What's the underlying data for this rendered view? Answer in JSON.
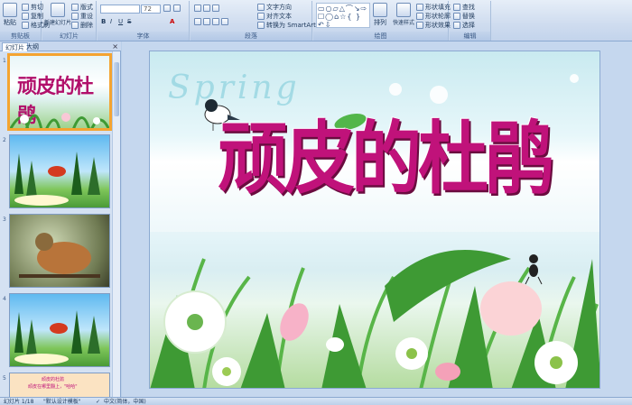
{
  "ribbon": {
    "clipboard": {
      "paste": "粘贴",
      "cut": "剪切",
      "copy": "复制",
      "format_painter": "格式刷",
      "label": "剪贴板"
    },
    "slides": {
      "new_slide": "新建幻灯片",
      "layout": "版式",
      "reset": "重设",
      "delete": "删除",
      "label": "幻灯片"
    },
    "font": {
      "font_size": "72",
      "label": "字体",
      "bold": "B",
      "italic": "I",
      "underline": "U",
      "strike": "S",
      "font_color": "A"
    },
    "paragraph": {
      "text_direction": "文字方向",
      "align_text": "对齐文本",
      "smartart": "转换为 SmartArt",
      "label": "段落"
    },
    "drawing": {
      "arrange": "排列",
      "quick_styles": "快速样式",
      "shape_fill": "形状填充",
      "shape_outline": "形状轮廓",
      "shape_effects": "形状效果",
      "label": "绘图"
    },
    "editing": {
      "find": "查找",
      "replace": "替换",
      "select": "选择",
      "label": "编辑"
    }
  },
  "left_panel": {
    "tabs": [
      "幻灯片",
      "大纲"
    ],
    "close": "×",
    "thumbnails": [
      {
        "num": "1",
        "title": "顽皮的杜鹃"
      },
      {
        "num": "2"
      },
      {
        "num": "3"
      },
      {
        "num": "4"
      },
      {
        "num": "5",
        "line1": "顽皮的杜鹃",
        "line2": "顽皮在哪里翻上，\"哈哈\""
      }
    ]
  },
  "slide": {
    "title": "顽皮的杜鹃",
    "watermark": "Spring"
  },
  "statusbar": {
    "slide_count": "幻灯片 1/18",
    "theme": "\"默认设计模板\"",
    "language": "中文(简体，中国)"
  },
  "colors": {
    "accent": "#c0127a",
    "ribbon": "#cfdcef",
    "selection": "#f4a431"
  }
}
